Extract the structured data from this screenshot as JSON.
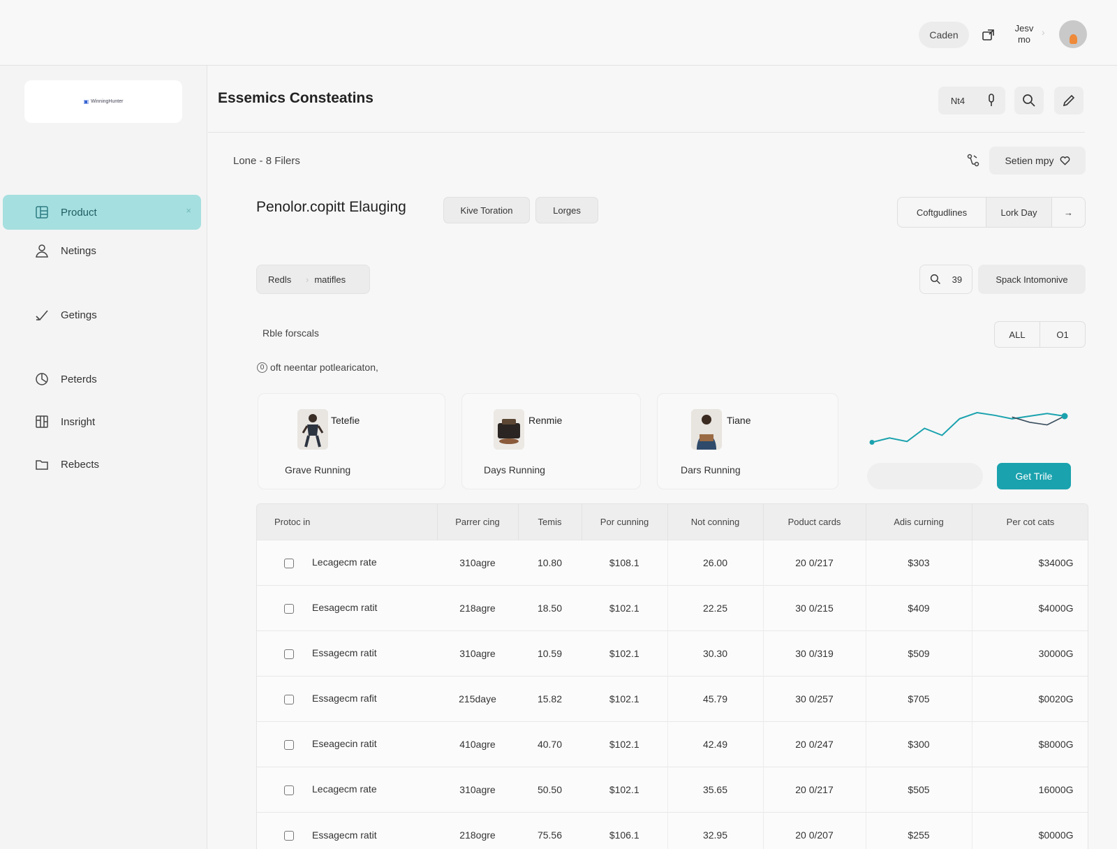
{
  "topbar": {
    "button_label": "Caden",
    "user_name_line1": "Jesv",
    "user_name_line2": "mo",
    "chevron": "›"
  },
  "sidebar": {
    "logo_text": "WinningHunter",
    "items": [
      {
        "label": "Product",
        "icon": "layout-icon",
        "active": true,
        "close": "×"
      },
      {
        "label": "Netings",
        "icon": "user-icon",
        "active": false
      },
      {
        "label": "Getings",
        "icon": "check-icon",
        "active": false
      },
      {
        "label": "Peterds",
        "icon": "chart-icon",
        "active": false
      },
      {
        "label": "Insright",
        "icon": "grid-icon",
        "active": false
      },
      {
        "label": "Rebects",
        "icon": "folder-icon",
        "active": false
      }
    ]
  },
  "header": {
    "title": "Essemics Consteatins",
    "group_label": "Nt4"
  },
  "filters": {
    "summary": "Lone - 8 Filers",
    "section_button": "Setien mpy"
  },
  "subheader": {
    "title": "Penolor.copitt Elauging",
    "pills": [
      "Kive Toration",
      "Lorges"
    ],
    "segments": [
      "Coftgudlines",
      "Lork Day",
      "→"
    ]
  },
  "breadcrumb": [
    "Redls",
    "matifles"
  ],
  "search": {
    "count": "39",
    "spack_label": "Spack Intomonive"
  },
  "role_label": "Rble forscals",
  "toggle": [
    "ALL",
    "O1"
  ],
  "notice": {
    "num": "0",
    "text": "oft neentar potlearicaton,"
  },
  "cards": [
    {
      "name": "Tetefie",
      "meta": "Grave Running"
    },
    {
      "name": "Renmie",
      "meta": "Days Running"
    },
    {
      "name": "Tiane",
      "meta": "Dars Running"
    }
  ],
  "get_button": "Get Trile",
  "accent_color": "#1aa2ae",
  "chart_data": {
    "type": "line",
    "x": [
      0,
      1,
      2,
      3,
      4,
      5,
      6,
      7,
      8,
      9,
      10,
      11
    ],
    "series": [
      {
        "values": [
          10,
          15,
          11,
          26,
          18,
          37,
          44,
          41,
          37,
          40,
          43,
          40
        ]
      },
      {
        "values": [
          null,
          null,
          null,
          null,
          null,
          null,
          null,
          null,
          39,
          33,
          30,
          40
        ]
      }
    ]
  },
  "table": {
    "headers": [
      "Protoc in",
      "Parrer cing",
      "Temis",
      "Por cunning",
      "Not conning",
      "Poduct cards",
      "Adis curning",
      "Per cot cats"
    ],
    "rows": [
      [
        "Lecagecm rate",
        "310agre",
        "10.80",
        "$108.1",
        "26.00",
        "20 0/217",
        "$303",
        "$3400G"
      ],
      [
        "Eesagecm ratit",
        "218agre",
        "18.50",
        "$102.1",
        "22.25",
        "30 0/215",
        "$409",
        "$4000G"
      ],
      [
        "Essagecm ratit",
        "310agre",
        "10.59",
        "$102.1",
        "30.30",
        "30 0/319",
        "$509",
        "30000G"
      ],
      [
        "Essagecm rafit",
        "215daye",
        "15.82",
        "$102.1",
        "45.79",
        "30 0/257",
        "$705",
        "$0020G"
      ],
      [
        "Eseagecin ratit",
        "410agre",
        "40.70",
        "$102.1",
        "42.49",
        "20 0/247",
        "$300",
        "$8000G"
      ],
      [
        "Lecagecm rate",
        "310agre",
        "50.50",
        "$102.1",
        "35.65",
        "20 0/217",
        "$505",
        "16000G"
      ],
      [
        "Essagecm ratit",
        "218ogre",
        "75.56",
        "$106.1",
        "32.95",
        "20 0/207",
        "$255",
        "$0000G"
      ]
    ]
  }
}
